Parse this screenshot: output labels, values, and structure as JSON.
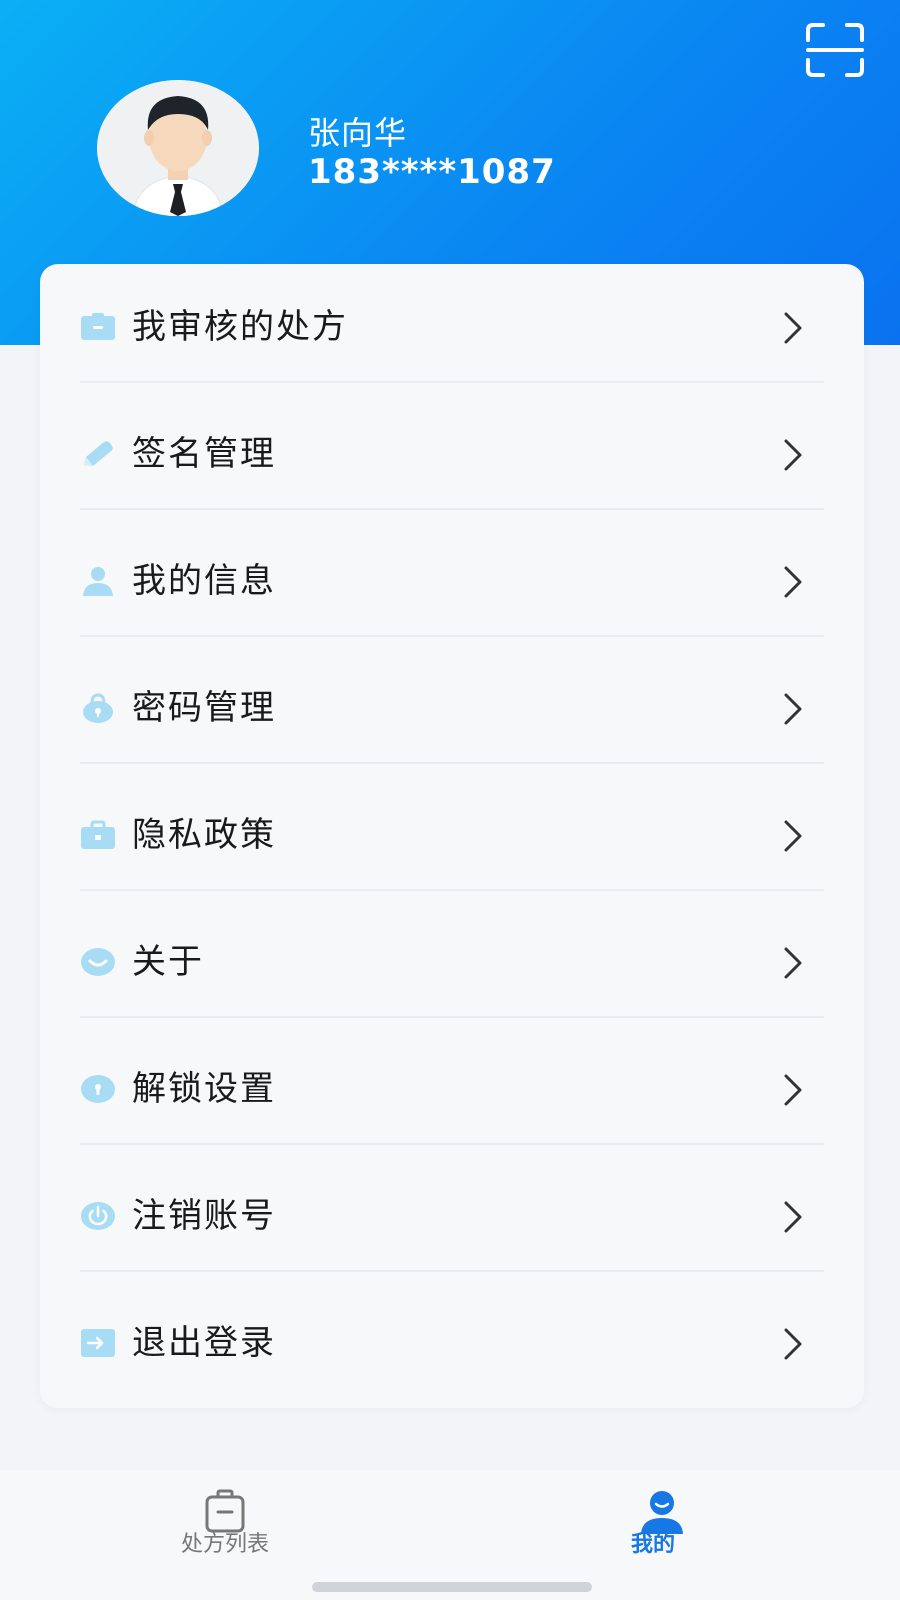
{
  "profile": {
    "name": "张向华",
    "phone": "183****1087",
    "avatar_icon": "doctor-avatar-icon",
    "scan_icon": "scan-icon"
  },
  "menu": {
    "items": [
      {
        "label": "我审核的处方",
        "icon": "prescription-folder-icon"
      },
      {
        "label": "签名管理",
        "icon": "pencil-icon"
      },
      {
        "label": "我的信息",
        "icon": "user-icon"
      },
      {
        "label": "密码管理",
        "icon": "lock-icon"
      },
      {
        "label": "隐私政策",
        "icon": "privacy-briefcase-icon"
      },
      {
        "label": "关于",
        "icon": "smile-icon"
      },
      {
        "label": "解锁设置",
        "icon": "unlock-icon"
      },
      {
        "label": "注销账号",
        "icon": "power-icon"
      },
      {
        "label": "退出登录",
        "icon": "logout-icon"
      }
    ]
  },
  "tabbar": {
    "tabs": [
      {
        "label": "处方列表",
        "icon": "clipboard-icon",
        "active": false
      },
      {
        "label": "我的",
        "icon": "profile-tab-icon",
        "active": true
      }
    ]
  },
  "colors": {
    "header_start": "#0ab0f5",
    "header_end": "#0a72f0",
    "icon_light_blue": "#a8dcf5",
    "tab_active": "#1677e5",
    "tab_inactive": "#777777"
  }
}
